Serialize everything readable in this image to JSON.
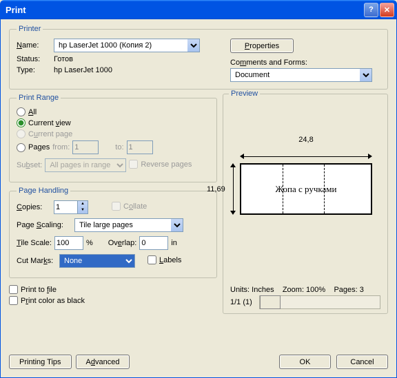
{
  "title": "Print",
  "printer": {
    "legend": "Printer",
    "name_label": "Name:",
    "name_value": "hp LaserJet 1000 (Копия 2)",
    "status_label": "Status:",
    "status_value": "Готов",
    "type_label": "Type:",
    "type_value": "hp LaserJet 1000",
    "properties_btn": "Properties",
    "comments_label": "Comments and Forms:",
    "comments_value": "Document"
  },
  "range": {
    "legend": "Print Range",
    "all": "All",
    "current_view": "Current view",
    "current_page": "Current page",
    "pages": "Pages",
    "from": "from:",
    "from_val": "1",
    "to": "to:",
    "to_val": "1",
    "subset": "Subset:",
    "subset_value": "All pages in range",
    "reverse": "Reverse pages"
  },
  "handling": {
    "legend": "Page Handling",
    "copies": "Copies:",
    "copies_val": "1",
    "collate": "Collate",
    "scaling": "Page Scaling:",
    "scaling_val": "Tile large pages",
    "tile_scale": "Tile Scale:",
    "tile_scale_val": "100",
    "pct": "%",
    "overlap": "Overlap:",
    "overlap_val": "0",
    "overlap_unit": "in",
    "cut_marks": "Cut Marks:",
    "cut_marks_val": "None",
    "labels": "Labels"
  },
  "print_to_file": "Print to file",
  "print_black": "Print color as black",
  "preview": {
    "legend": "Preview",
    "width": "24,8",
    "height": "11,69",
    "content": "Жопа с ручками",
    "units": "Units: Inches",
    "zoom": "Zoom: 100%",
    "pages": "Pages: 3",
    "slider_label": "1/1 (1)"
  },
  "buttons": {
    "tips": "Printing Tips",
    "advanced": "Advanced",
    "ok": "OK",
    "cancel": "Cancel"
  }
}
